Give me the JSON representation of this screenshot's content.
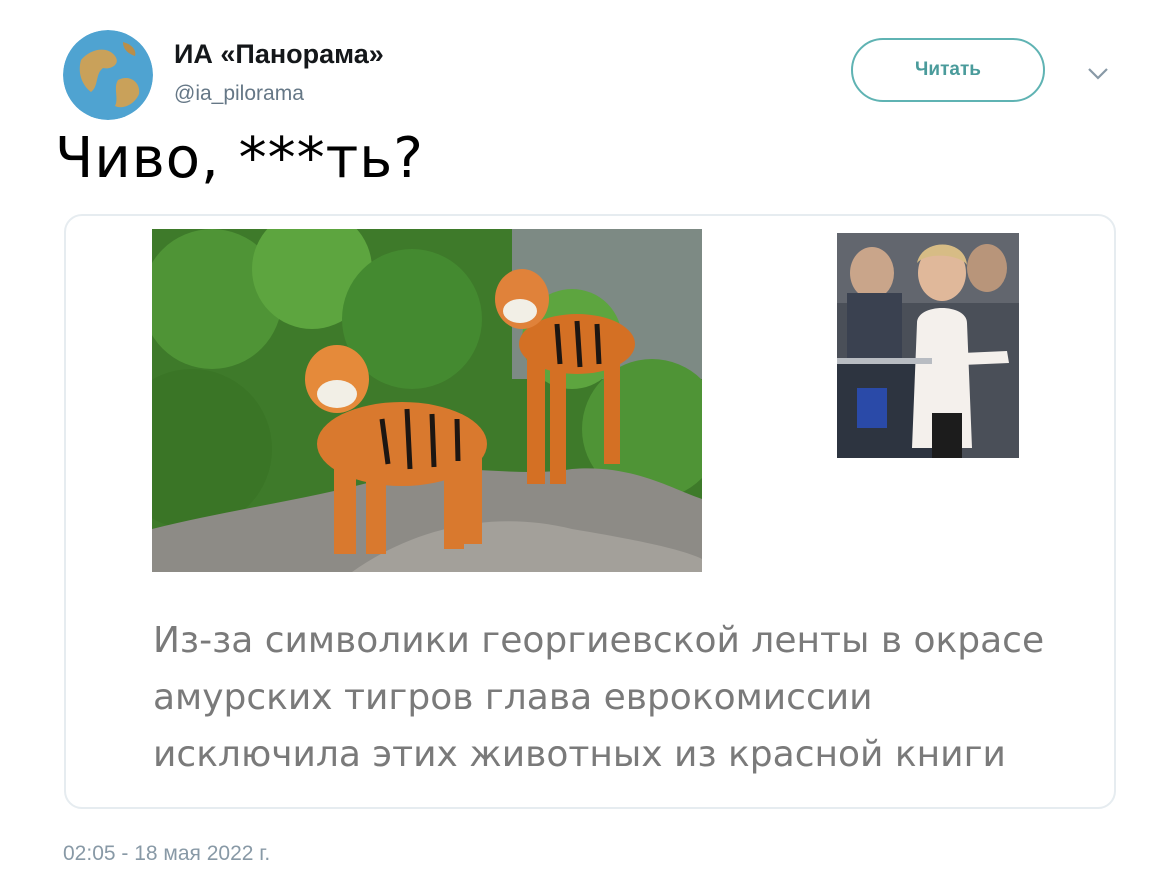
{
  "author": {
    "name": "ИА «Панорама»",
    "handle": "@ia_pilorama",
    "avatar_icon": "globe-icon"
  },
  "actions": {
    "follow_label": "Читать",
    "menu_icon": "chevron-down-icon"
  },
  "tweet": {
    "text": "Чиво, ***ть?"
  },
  "card": {
    "caption_lines": [
      "Из-за символики георгиевской ленты в окрасе",
      "амурских тигров глава еврокомиссии",
      "исключила этих животных из красной книги"
    ]
  },
  "timestamp": "02:05 - 18 мая 2022 г.",
  "colors": {
    "accent": "#4a9b9b",
    "caption": "#7a7a7a",
    "meta": "#8899a6"
  }
}
